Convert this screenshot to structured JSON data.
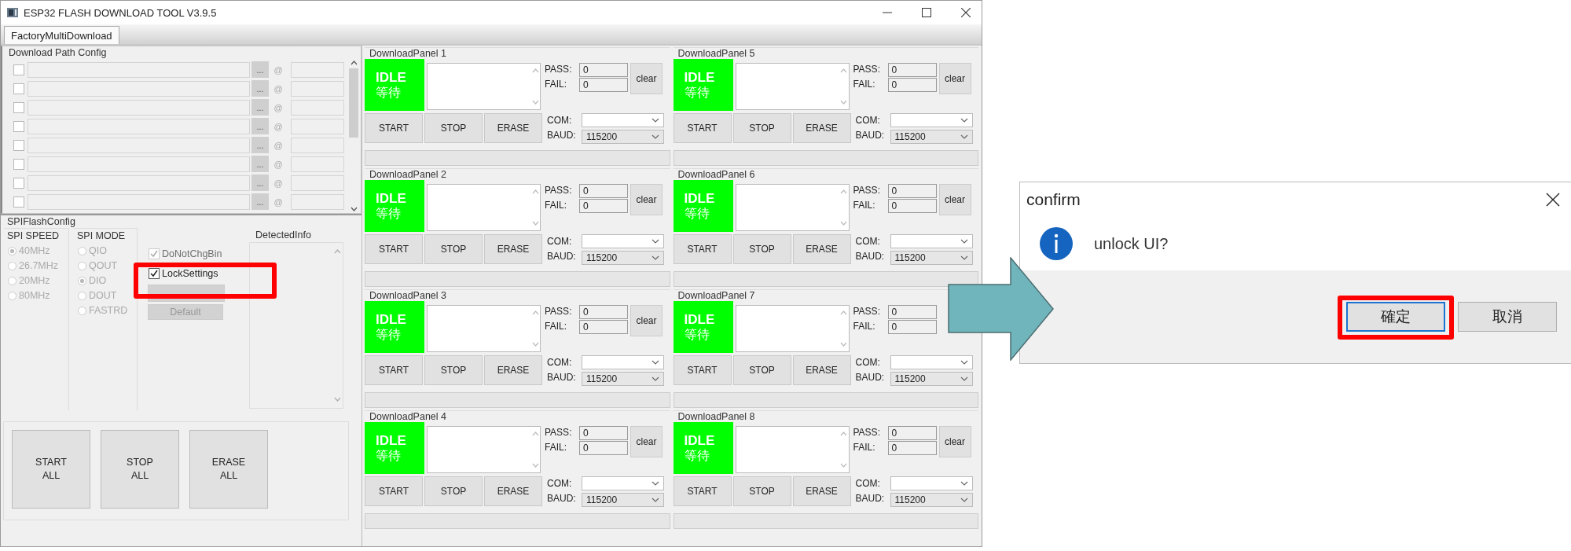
{
  "window": {
    "title": "ESP32 FLASH DOWNLOAD TOOL V3.9.5"
  },
  "tabs": [
    {
      "label": "FactoryMultiDownload",
      "selected": true
    }
  ],
  "download_path_config": {
    "title": "Download Path Config",
    "rows": [
      {
        "checked": false,
        "browse": "...",
        "at": "@"
      },
      {
        "checked": false,
        "browse": "...",
        "at": "@"
      },
      {
        "checked": false,
        "browse": "...",
        "at": "@"
      },
      {
        "checked": false,
        "browse": "...",
        "at": "@"
      },
      {
        "checked": false,
        "browse": "...",
        "at": "@"
      },
      {
        "checked": false,
        "browse": "...",
        "at": "@"
      },
      {
        "checked": false,
        "browse": "...",
        "at": "@"
      },
      {
        "checked": false,
        "browse": "...",
        "at": "@"
      }
    ]
  },
  "spi_flash_config": {
    "title": "SPIFlashConfig",
    "spi_speed": {
      "title": "SPI SPEED",
      "options": [
        {
          "label": "40MHz",
          "selected": true
        },
        {
          "label": "26.7MHz",
          "selected": false
        },
        {
          "label": "20MHz",
          "selected": false
        },
        {
          "label": "80MHz",
          "selected": false
        }
      ]
    },
    "spi_mode": {
      "title": "SPI MODE",
      "options": [
        {
          "label": "QIO",
          "selected": false
        },
        {
          "label": "QOUT",
          "selected": false
        },
        {
          "label": "DIO",
          "selected": true
        },
        {
          "label": "DOUT",
          "selected": false
        },
        {
          "label": "FASTRD",
          "selected": false
        }
      ]
    },
    "checkboxes": [
      {
        "label": "DoNotChgBin",
        "checked": true,
        "disabled": true,
        "highlighted": false
      },
      {
        "label": "LockSettings",
        "checked": true,
        "disabled": false,
        "highlighted": true
      }
    ],
    "default_button": {
      "label": "Default",
      "disabled": true
    },
    "detected_info": {
      "title": "DetectedInfo"
    }
  },
  "all_buttons": [
    "START\nALL",
    "STOP\nALL",
    "ERASE\nALL"
  ],
  "panels": [
    {
      "title": "DownloadPanel 1",
      "color": "#00ff00",
      "status": "IDLE",
      "status_local": "等待",
      "pass_label": "PASS:",
      "pass": "0",
      "fail_label": "FAIL:",
      "fail": "0",
      "clear": "clear",
      "buttons": [
        "START",
        "STOP",
        "ERASE"
      ],
      "com_label": "COM:",
      "baud_label": "BAUD:",
      "baud": "115200",
      "level": 0
    },
    {
      "title": "DownloadPanel 2",
      "color": "#00ff00",
      "status": "IDLE",
      "status_local": "等待",
      "pass_label": "PASS:",
      "pass": "0",
      "fail_label": "FAIL:",
      "fail": "0",
      "clear": "clear",
      "buttons": [
        "START",
        "STOP",
        "ERASE"
      ],
      "com_label": "COM:",
      "baud_label": "BAUD:",
      "baud": "115200",
      "level": 0
    },
    {
      "title": "DownloadPanel 3",
      "color": "#00ff00",
      "status": "IDLE",
      "status_local": "等待",
      "pass_label": "PASS:",
      "pass": "0",
      "fail_label": "FAIL:",
      "fail": "0",
      "clear": "clear",
      "buttons": [
        "START",
        "STOP",
        "ERASE"
      ],
      "com_label": "COM:",
      "baud_label": "BAUD:",
      "baud": "115200",
      "level": 0
    },
    {
      "title": "DownloadPanel 4",
      "color": "#00ff00",
      "status": "IDLE",
      "status_local": "等待",
      "pass_label": "PASS:",
      "pass": "0",
      "fail_label": "FAIL:",
      "fail": "0",
      "clear": "clear",
      "buttons": [
        "START",
        "STOP",
        "ERASE"
      ],
      "com_label": "COM:",
      "baud_label": "BAUD:",
      "baud": "115200",
      "level": 0
    },
    {
      "title": "DownloadPanel 5",
      "color": "#00ff00",
      "status": "IDLE",
      "status_local": "等待",
      "pass_label": "PASS:",
      "pass": "0",
      "fail_label": "FAIL:",
      "fail": "0",
      "clear": "clear",
      "buttons": [
        "START",
        "STOP",
        "ERASE"
      ],
      "com_label": "COM:",
      "baud_label": "BAUD:",
      "baud": "115200",
      "level": 0
    },
    {
      "title": "DownloadPanel 6",
      "color": "#00ff00",
      "status": "IDLE",
      "status_local": "等待",
      "pass_label": "PASS:",
      "pass": "0",
      "fail_label": "FAIL:",
      "fail": "0",
      "clear": "clear",
      "buttons": [
        "START",
        "STOP",
        "ERASE"
      ],
      "com_label": "COM:",
      "baud_label": "BAUD:",
      "baud": "115200",
      "level": 0
    },
    {
      "title": "DownloadPanel 7",
      "color": "#00ff00",
      "status": "IDLE",
      "status_local": "等待",
      "pass_label": "PASS:",
      "pass": "0",
      "fail_label": "FAIL:",
      "fail": "0",
      "buttons": [
        "START",
        "STOP",
        "ERASE"
      ],
      "com_label": "COM:",
      "baud_label": "BAUD:",
      "baud": "115200",
      "level": 0
    },
    {
      "title": "DownloadPanel 8",
      "color": "#00ff00",
      "status": "IDLE",
      "status_local": "等待",
      "pass_label": "PASS:",
      "pass": "0",
      "fail_label": "FAIL:",
      "fail": "0",
      "clear": "clear",
      "buttons": [
        "START",
        "STOP",
        "ERASE"
      ],
      "com_label": "COM:",
      "baud_label": "BAUD:",
      "baud": "115200",
      "level": 0
    }
  ],
  "dialog": {
    "title": "confirm",
    "message": "unlock UI?",
    "buttons": [
      {
        "label": "確定",
        "selected": true,
        "highlighted": true
      },
      {
        "label": "取消",
        "selected": false,
        "highlighted": false
      }
    ]
  }
}
